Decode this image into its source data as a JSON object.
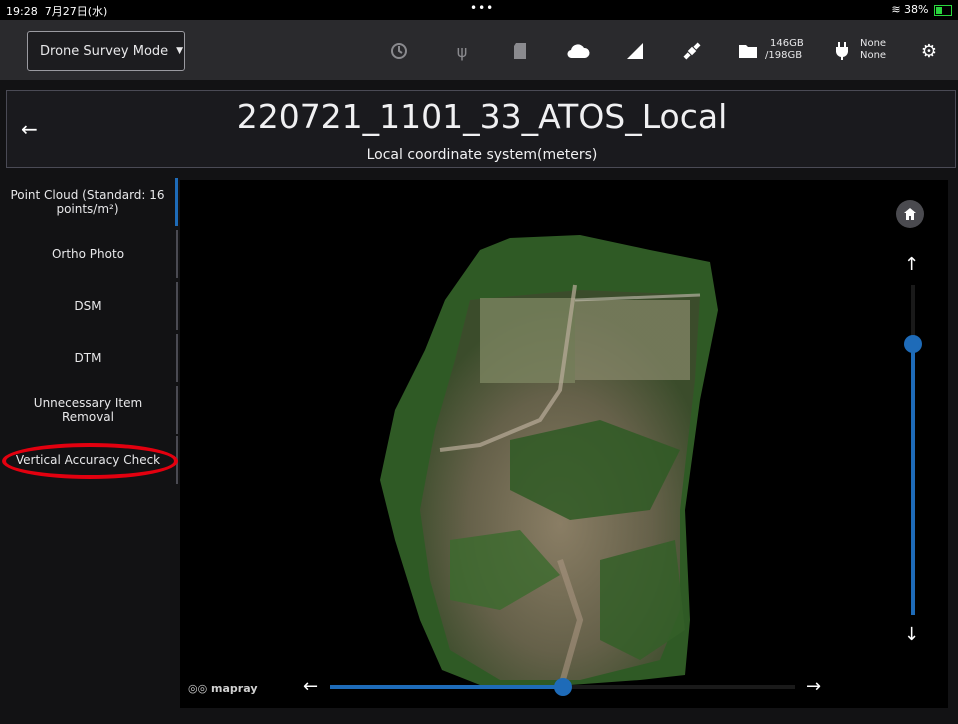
{
  "status_bar": {
    "time": "19:28",
    "date": "7月27日(水)",
    "dots": "•••",
    "battery_text": "38%"
  },
  "toolbar": {
    "mode_label": "Drone Survey Mode",
    "storage_used": "146GB",
    "storage_total": "/198GB",
    "power_top": "None",
    "power_bottom": "None",
    "icons": [
      "camera-timer-icon",
      "usb-icon",
      "sd-card-icon",
      "cloud-icon",
      "signal-icon",
      "satellite-icon",
      "folder-icon",
      "plug-icon",
      "gear-icon"
    ]
  },
  "header": {
    "title": "220721_1101_33_ATOS_Local",
    "subtitle": "Local coordinate system(meters)"
  },
  "sidebar": {
    "items": [
      {
        "label": "Point Cloud (Standard: 16 points/m²)"
      },
      {
        "label": "Ortho Photo"
      },
      {
        "label": "DSM"
      },
      {
        "label": "DTM"
      },
      {
        "label": "Unnecessary Item Removal"
      },
      {
        "label": "Vertical Accuracy Check"
      }
    ]
  },
  "viewer": {
    "logo_text": "mapray",
    "vertical_slider_value": 0.82,
    "horizontal_slider_value": 0.5
  },
  "colors": {
    "accent": "#1e6bb8",
    "highlight": "#e3000f",
    "battery": "#29d53d"
  }
}
